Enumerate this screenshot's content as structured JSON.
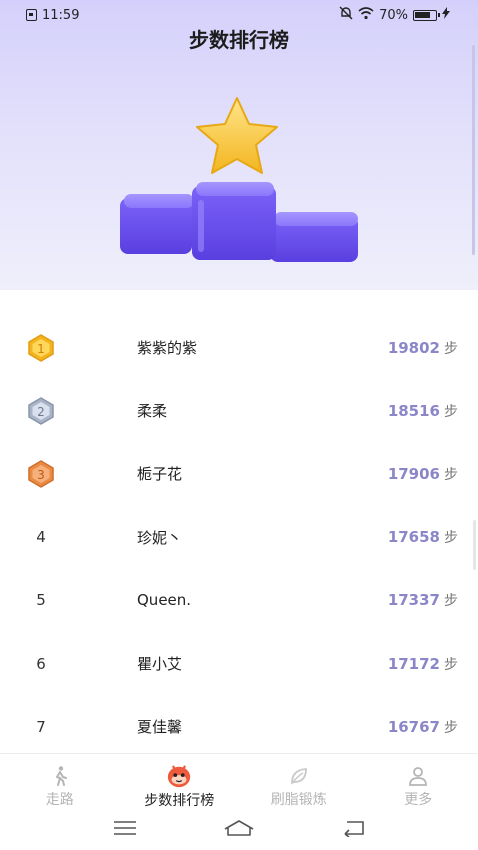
{
  "status_bar": {
    "time": "11:59",
    "battery_percent": "70%",
    "icons": [
      "sim-icon",
      "mute-icon",
      "wifi-icon",
      "battery-icon",
      "charging-icon"
    ]
  },
  "page": {
    "title": "步数排行榜"
  },
  "hero_image": {
    "description_icon": "podium-star-illustration",
    "colors": {
      "podium": "#6a4ff0",
      "star": "#f7c53a"
    }
  },
  "ranking": {
    "unit": "步",
    "rows": [
      {
        "rank": "1",
        "name": "紫紫的紫",
        "steps": "19802",
        "medal": "gold"
      },
      {
        "rank": "2",
        "name": "柔柔",
        "steps": "18516",
        "medal": "silver"
      },
      {
        "rank": "3",
        "name": "栀子花",
        "steps": "17906",
        "medal": "bronze"
      },
      {
        "rank": "4",
        "name": "珍妮丶",
        "steps": "17658"
      },
      {
        "rank": "5",
        "name": "Queen.",
        "steps": "17337"
      },
      {
        "rank": "6",
        "name": "瞿小艾",
        "steps": "17172"
      },
      {
        "rank": "7",
        "name": "夏佳馨",
        "steps": "16767"
      }
    ]
  },
  "bottom_nav": {
    "items": [
      {
        "label": "走路",
        "icon": "walk-icon",
        "active": false
      },
      {
        "label": "步数排行榜",
        "icon": "ranking-mascot-icon",
        "active": true
      },
      {
        "label": "刷脂锻炼",
        "icon": "leaf-icon",
        "active": false
      },
      {
        "label": "更多",
        "icon": "user-icon",
        "active": false
      }
    ]
  },
  "system_nav": {
    "icons": [
      "menu-icon",
      "home-icon",
      "back-icon"
    ]
  },
  "colors": {
    "accent": "#8b86c8",
    "hero_top": "#d4d0fb",
    "gold": "#f3b51f",
    "silver": "#a9b4c6",
    "bronze": "#e98b45",
    "mascot": "#f05a3c"
  }
}
